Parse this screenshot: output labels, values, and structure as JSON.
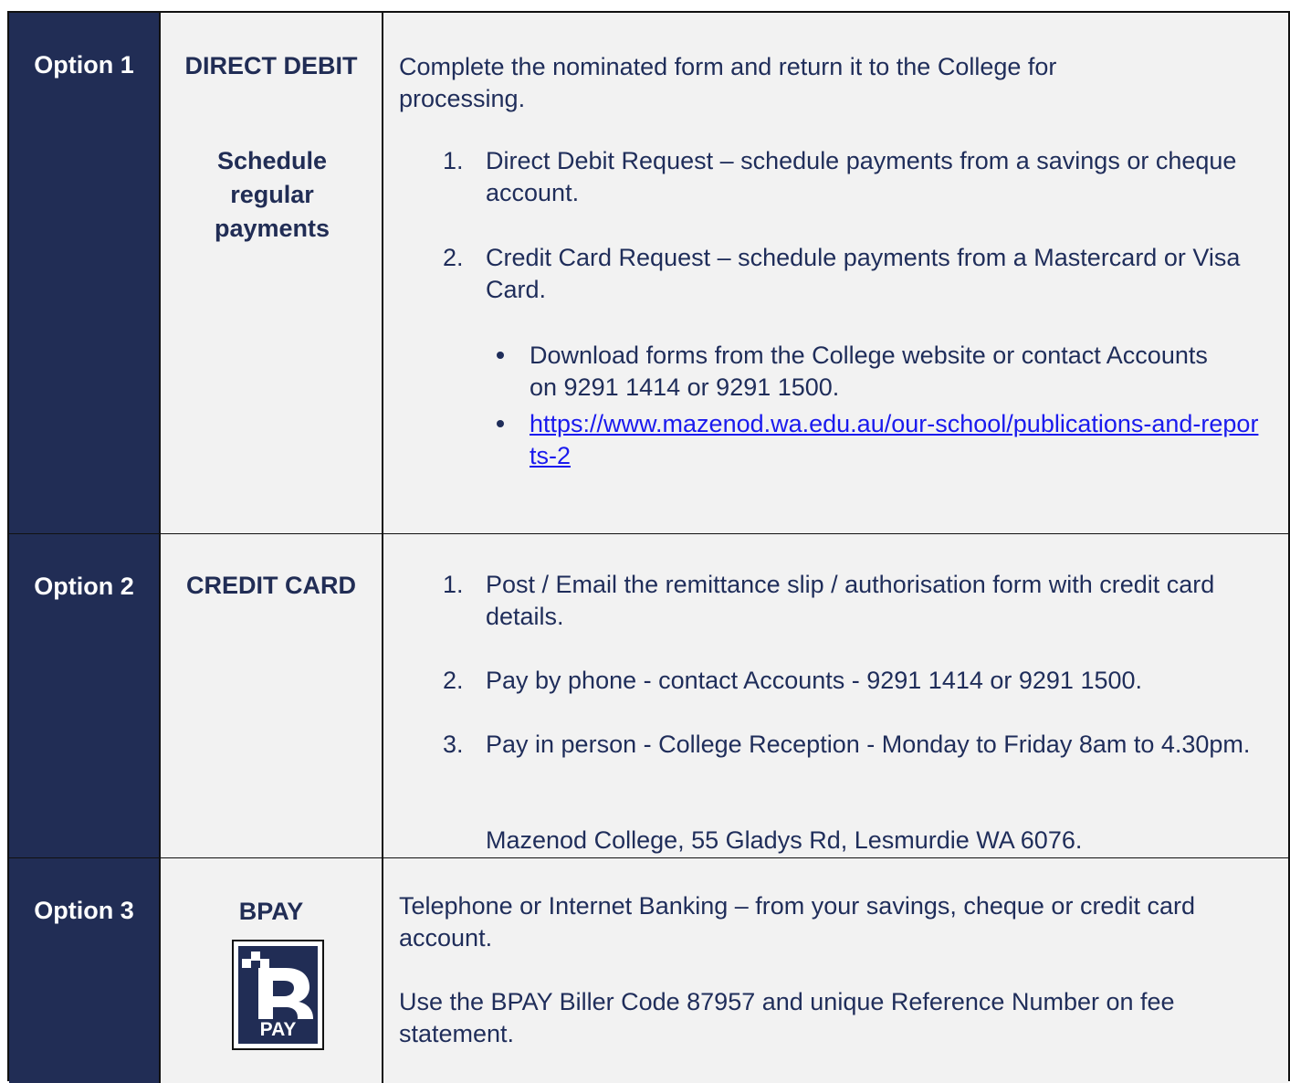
{
  "options": [
    {
      "option_label": "Option 1",
      "method": "DIRECT DEBIT",
      "sub_method": "Schedule regular payments",
      "intro": "Complete the nominated form and return it to the College for processing.",
      "items": [
        {
          "num": "1.",
          "text": "Direct Debit Request – schedule payments from a savings or cheque account."
        },
        {
          "num": "2.",
          "text": "Credit Card Request – schedule payments from a Mastercard or Visa Card."
        }
      ],
      "bullets": [
        "Download forms from the College website or contact Accounts on 9291 1414 or 9291 1500.",
        "https://www.mazenod.wa.edu.au/our-school/publications-and-reports-2"
      ]
    },
    {
      "option_label": "Option 2",
      "method": "CREDIT CARD",
      "items": [
        {
          "num": "1.",
          "text": "Post / Email the remittance slip / authorisation form with credit card details."
        },
        {
          "num": "2.",
          "text": "Pay by phone - contact Accounts - 9291 1414 or 9291 1500."
        },
        {
          "num": "3.",
          "text": "Pay in person - College Reception - Monday to Friday 8am to 4.30pm."
        }
      ],
      "address": "Mazenod College, 55 Gladys Rd, Lesmurdie WA 6076."
    },
    {
      "option_label": "Option 3",
      "method": "BPAY",
      "logo_text": "PAY",
      "paragraphs": [
        "Telephone or Internet Banking – from your savings, cheque or credit card account.",
        "Use the BPAY Biller Code 87957 and unique Reference Number on fee statement."
      ]
    }
  ],
  "colors": {
    "navy": "#212d55",
    "cell_bg": "#f2f2f2",
    "link": "#1a1aee"
  }
}
